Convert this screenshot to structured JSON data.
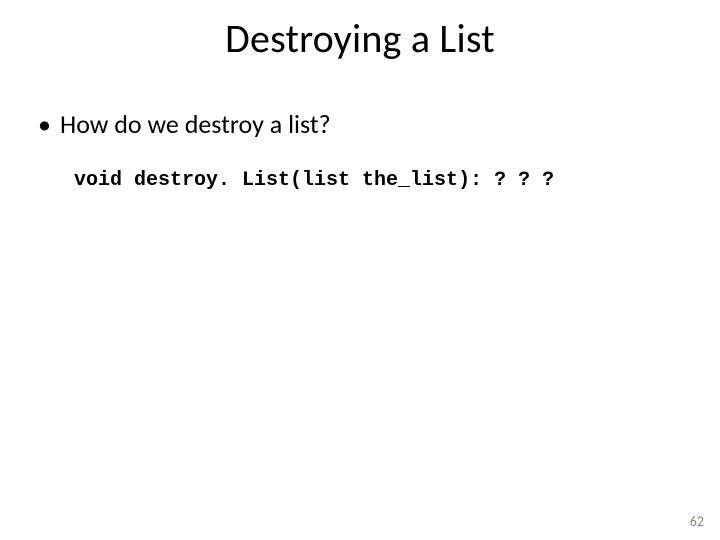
{
  "title": "Destroying a List",
  "bullet": {
    "marker": "•",
    "text": "How do we destroy a list?"
  },
  "code": "void destroy. List(list the_list): ? ? ?",
  "page_number": "62"
}
